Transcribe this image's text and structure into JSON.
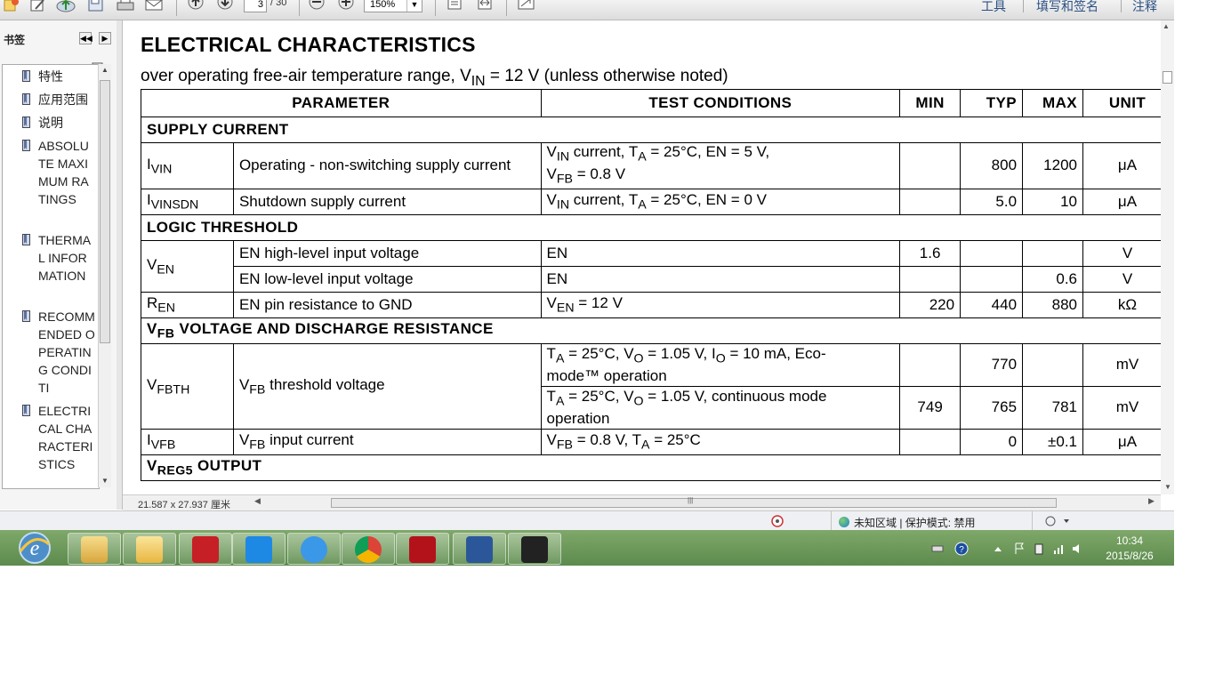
{
  "toolbar": {
    "page_current": "3",
    "page_total": "/ 30",
    "zoom": "150%",
    "right_tools": [
      "工具",
      "填写和签名",
      "注释"
    ]
  },
  "bookmarks": {
    "title": "书签",
    "items": [
      {
        "label": "特性"
      },
      {
        "label": "应用范围"
      },
      {
        "label": "说明"
      },
      {
        "label": "ABSOLUTE MAXIMUM RATINGS"
      },
      {
        "label": "THERMAL INFORMATION"
      },
      {
        "label": "RECOMMENDED OPERATING CONDITI"
      },
      {
        "label": "ELECTRICAL CHARACTERISTICS"
      }
    ]
  },
  "doc": {
    "heading": "ELECTRICAL CHARACTERISTICS",
    "subtitle_pre": "over operating free-air temperature range, V",
    "subtitle_sub": "IN",
    "subtitle_post": " = 12 V (unless otherwise noted)",
    "headers": {
      "parameter": "PARAMETER",
      "conditions": "TEST CONDITIONS",
      "min": "MIN",
      "typ": "TYP",
      "max": "MAX",
      "unit": "UNIT"
    },
    "sections": {
      "supply": "SUPPLY CURRENT",
      "logic": "LOGIC THRESHOLD",
      "vfb_pre": "V",
      "vfb_sub": "FB",
      "vfb_post": " VOLTAGE AND DISCHARGE RESISTANCE",
      "vreg_pre": "V",
      "vreg_sub": "REG5",
      "vreg_post": " OUTPUT"
    },
    "rows": {
      "ivin": {
        "sym": "I",
        "sub": "VIN",
        "desc": "Operating - non-switching supply current",
        "c1": "V",
        "c1s": "IN",
        "c2": " current, T",
        "c2s": "A",
        "c3": " = 25°C, EN = 5 V,",
        "c4": "V",
        "c4s": "FB",
        "c5": " = 0.8 V",
        "min": "",
        "typ": "800",
        "max": "1200",
        "unit": "μA"
      },
      "ivinsdn": {
        "sym": "I",
        "sub": "VINSDN",
        "desc": "Shutdown supply current",
        "c1": "V",
        "c1s": "IN",
        "c2": " current, T",
        "c2s": "A",
        "c3": " = 25°C, EN = 0 V",
        "min": "",
        "typ": "5.0",
        "max": "10",
        "unit": "μA"
      },
      "ven": {
        "sym": "V",
        "sub": "EN"
      },
      "ven_hi": {
        "desc": "EN high-level input voltage",
        "cond": "EN",
        "min": "1.6",
        "typ": "",
        "max": "",
        "unit": "V"
      },
      "ven_lo": {
        "desc": "EN low-level input voltage",
        "cond": "EN",
        "min": "",
        "typ": "",
        "max": "0.6",
        "unit": "V"
      },
      "ren": {
        "sym": "R",
        "sub": "EN",
        "desc": "EN pin resistance to GND",
        "c1": "V",
        "c1s": "EN",
        "c2": " = 12 V",
        "min": "220",
        "typ": "440",
        "max": "880",
        "unit": "kΩ"
      },
      "vfbth": {
        "sym": "V",
        "sub": "FBTH",
        "desc_pre": "V",
        "desc_sub": "FB",
        "desc_post": " threshold voltage"
      },
      "vfbth_a": {
        "c1": "T",
        "c1s": "A",
        "c2": " = 25°C, V",
        "c2s": "O",
        "c3": " = 1.05 V, I",
        "c3s": "O",
        "c4": " = 10 mA, Eco-",
        "c5": "mode™ operation",
        "min": "",
        "typ": "770",
        "max": "",
        "unit": "mV"
      },
      "vfbth_b": {
        "c1": "T",
        "c1s": "A",
        "c2": " = 25°C, V",
        "c2s": "O",
        "c3": " = 1.05 V, continuous mode",
        "c4": "operation",
        "min": "749",
        "typ": "765",
        "max": "781",
        "unit": "mV"
      },
      "ivfb": {
        "sym": "I",
        "sub": "VFB",
        "desc_pre": "V",
        "desc_sub": "FB",
        "desc_post": " input current",
        "c1": "V",
        "c1s": "FB",
        "c2": " = 0.8 V, T",
        "c2s": "A",
        "c3": " = 25°C",
        "min": "",
        "typ": "0",
        "max": "±0.1",
        "unit": "μA"
      }
    },
    "page_size": "21.587 x 27.937 厘米"
  },
  "statusbar": {
    "zone": "未知区域 | 保护模式: 禁用"
  },
  "taskbar": {
    "time": "10:34",
    "date": "2015/8/26"
  }
}
